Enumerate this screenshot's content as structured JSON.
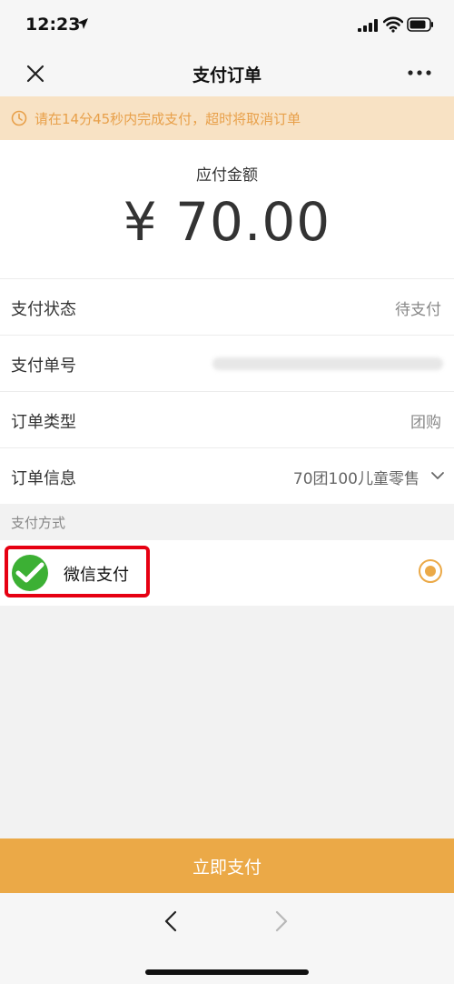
{
  "status_bar": {
    "time": "12:23"
  },
  "nav": {
    "title": "支付订单"
  },
  "notice": {
    "text": "请在14分45秒内完成支付，超时将取消订单"
  },
  "amount": {
    "label": "应付金额",
    "value": "¥ 70.00"
  },
  "info_rows": [
    {
      "label": "支付状态",
      "value": "待支付"
    },
    {
      "label": "支付单号",
      "value": ""
    },
    {
      "label": "订单类型",
      "value": "团购"
    },
    {
      "label": "订单信息",
      "value": "70团100儿童零售"
    }
  ],
  "payment": {
    "section_title": "支付方式",
    "method_label": "微信支付"
  },
  "actions": {
    "pay_button": "立即支付"
  },
  "colors": {
    "accent": "#eba947",
    "notice_bg": "#f8e2c4",
    "notice_text": "#e8a04a",
    "wechat_green": "#3cb034",
    "highlight_red": "#e60012"
  },
  "icons": {
    "location": "location-arrow-icon",
    "signal": "signal-icon",
    "wifi": "wifi-icon",
    "battery": "battery-icon",
    "close": "close-icon",
    "more": "more-icon",
    "clock": "clock-icon",
    "wechat": "wechat-pay-icon",
    "radio": "radio-selected-icon",
    "back": "back-icon",
    "forward": "forward-icon"
  }
}
